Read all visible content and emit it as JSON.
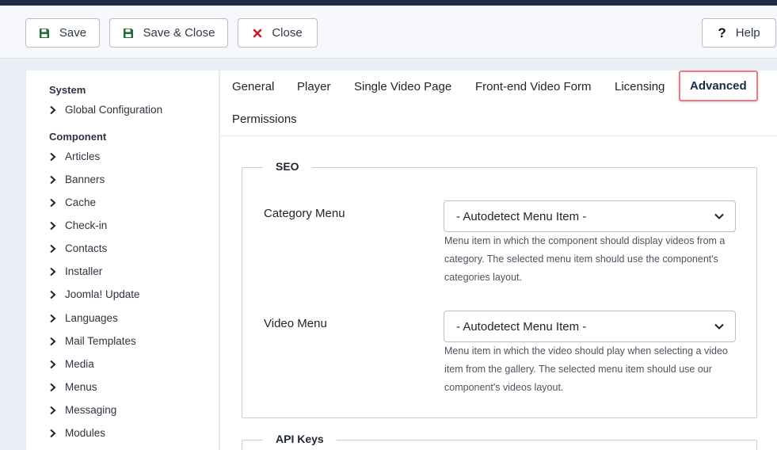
{
  "toolbar": {
    "save_label": "Save",
    "save_close_label": "Save & Close",
    "close_label": "Close",
    "help_label": "Help"
  },
  "sidebar": {
    "system_heading": "System",
    "system_items": [
      "Global Configuration"
    ],
    "component_heading": "Component",
    "component_items": [
      "Articles",
      "Banners",
      "Cache",
      "Check-in",
      "Contacts",
      "Installer",
      "Joomla! Update",
      "Languages",
      "Mail Templates",
      "Media",
      "Menus",
      "Messaging",
      "Modules"
    ]
  },
  "tabs": [
    "General",
    "Player",
    "Single Video Page",
    "Front-end Video Form",
    "Licensing",
    "Advanced",
    "Permissions"
  ],
  "active_tab": "Advanced",
  "seo": {
    "legend": "SEO",
    "category_menu": {
      "label": "Category Menu",
      "value": "- Autodetect Menu Item -",
      "help": "Menu item in which the component should display videos from a category. The selected menu item should use the component's categories layout."
    },
    "video_menu": {
      "label": "Video Menu",
      "value": "- Autodetect Menu Item -",
      "help": "Menu item in which the video should play when selecting a video item from the gallery. The selected menu item should use our component's videos layout."
    }
  },
  "api_keys": {
    "legend": "API Keys"
  },
  "colors": {
    "accent": "#e87b86",
    "header": "#1b2b40",
    "save_icon": "#2a6b3b",
    "close_icon": "#c61d2b"
  },
  "icons": {
    "save": "floppy-disk-icon",
    "close": "x-icon",
    "help": "question-mark-icon",
    "expand": "chevron-right-icon",
    "select": "chevron-down-icon"
  }
}
